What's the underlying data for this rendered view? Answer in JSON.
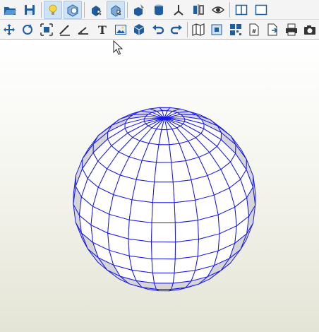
{
  "toolbar_top": [
    {
      "name": "open-folder-icon",
      "state": "normal"
    },
    {
      "name": "save-icon",
      "state": "normal"
    },
    {
      "sep": true
    },
    {
      "name": "lightbulb-icon",
      "state": "active"
    },
    {
      "name": "shading-icon",
      "state": "active"
    },
    {
      "sep": true
    },
    {
      "name": "select-solid-icon",
      "state": "normal"
    },
    {
      "name": "select-face-icon",
      "state": "active"
    },
    {
      "sep": true
    },
    {
      "name": "paint-cube-icon",
      "state": "normal"
    },
    {
      "name": "cylinder-icon",
      "state": "normal"
    },
    {
      "name": "axes-icon",
      "state": "normal"
    },
    {
      "name": "section-icon",
      "state": "normal"
    },
    {
      "name": "eye-icon",
      "state": "normal"
    },
    {
      "sep": true
    },
    {
      "name": "split-view-icon",
      "state": "normal"
    },
    {
      "name": "single-view-icon",
      "state": "normal"
    }
  ],
  "toolbar_bottom": [
    {
      "name": "pan-icon",
      "state": "normal"
    },
    {
      "name": "rotate-icon",
      "state": "normal"
    },
    {
      "name": "fit-icon",
      "state": "normal"
    },
    {
      "name": "measure-icon",
      "state": "normal"
    },
    {
      "name": "angle-icon",
      "state": "normal"
    },
    {
      "name": "text-icon",
      "state": "normal",
      "label": "T"
    },
    {
      "name": "image-icon",
      "state": "normal"
    },
    {
      "name": "cube-icon",
      "state": "normal"
    },
    {
      "name": "undo-icon",
      "state": "normal"
    },
    {
      "name": "redo-icon",
      "state": "normal"
    },
    {
      "sep": true
    },
    {
      "name": "map-icon",
      "state": "normal"
    },
    {
      "name": "zoom-fit-icon",
      "state": "normal"
    },
    {
      "name": "tile-icon",
      "state": "normal"
    },
    {
      "name": "number-page-icon",
      "state": "normal",
      "label": "#"
    },
    {
      "name": "export-icon",
      "state": "normal"
    },
    {
      "name": "print-icon",
      "state": "normal"
    },
    {
      "name": "camera-icon",
      "state": "normal"
    }
  ],
  "colors": {
    "wire": "#1a1ae6",
    "face_light": "#ffffff",
    "face_shade": "#d6d6d6",
    "icon_blue": "#1f5d9e",
    "icon_dark": "#333333",
    "icon_yellow": "#f5d742"
  },
  "sphere": {
    "lat_bands": 14,
    "lon_segments": 24,
    "tilt_deg": 28
  }
}
